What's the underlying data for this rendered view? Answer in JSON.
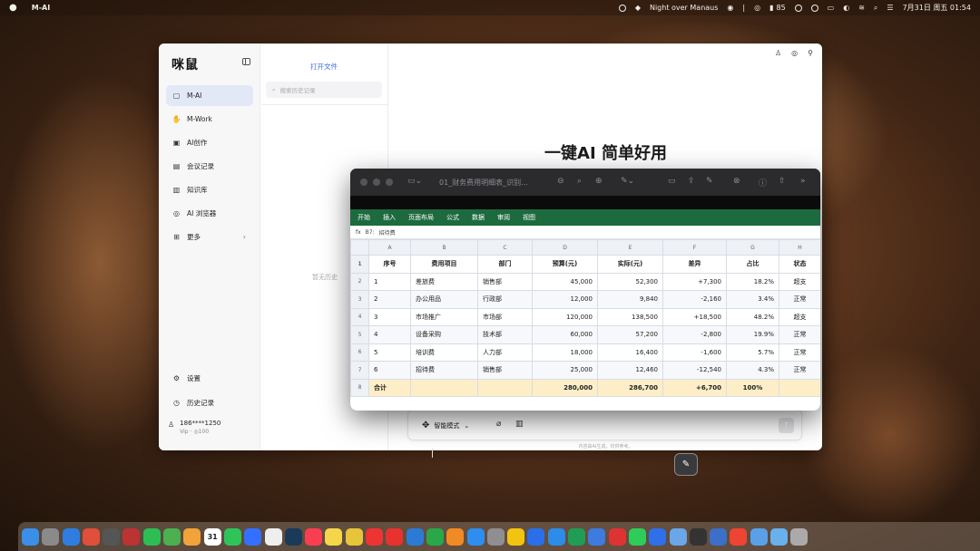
{
  "menubar": {
    "app_name": "M-AI",
    "now_playing": "Night over Manaus",
    "battery": "85",
    "datetime": "7月31日 周五 01:54"
  },
  "sidebar": {
    "logo": "咪鼠",
    "items": [
      {
        "label": "M-AI",
        "icon": "chat-icon",
        "active": true
      },
      {
        "label": "M-Work",
        "icon": "hand-icon"
      },
      {
        "label": "AI创作",
        "icon": "image-icon"
      },
      {
        "label": "会议记录",
        "icon": "meeting-icon"
      },
      {
        "label": "知识库",
        "icon": "book-icon"
      },
      {
        "label": "AI 浏览器",
        "icon": "compass-icon"
      },
      {
        "label": "更多",
        "icon": "grid-icon",
        "has_chevron": true
      }
    ],
    "bottom": [
      {
        "label": "设置",
        "icon": "gear-icon"
      },
      {
        "label": "历史记录",
        "icon": "history-icon"
      }
    ],
    "user": {
      "name": "186****1250",
      "tier": "Vip",
      "points": "100"
    }
  },
  "history": {
    "open_file": "打开文件",
    "search_placeholder": "搜索历史记录",
    "empty": "暂无历史"
  },
  "main": {
    "headline": "一键AI 简单好用",
    "mode_label": "智能模式",
    "disclaimer": "内容由AI生成，仅供参考。"
  },
  "sheet": {
    "file_name": "01_财务费用明细表_识别...",
    "ribbon": [
      "开始",
      "插入",
      "页面布局",
      "公式",
      "数据",
      "审阅",
      "视图"
    ],
    "formula_bar": {
      "fx": "fx",
      "cell": "B7:",
      "value": "招待费"
    },
    "columns": [
      "A",
      "B",
      "C",
      "D",
      "E",
      "F",
      "G",
      "H"
    ],
    "header": [
      "序号",
      "费用项目",
      "部门",
      "预算(元)",
      "实际(元)",
      "差异",
      "占比",
      "状态"
    ],
    "rows": [
      [
        "1",
        "差旅费",
        "销售部",
        "45,000",
        "52,300",
        "+7,300",
        "18.2%",
        "超支"
      ],
      [
        "2",
        "办公用品",
        "行政部",
        "12,000",
        "9,840",
        "-2,160",
        "3.4%",
        "正常"
      ],
      [
        "3",
        "市场推广",
        "市场部",
        "120,000",
        "138,500",
        "+18,500",
        "48.2%",
        "超支"
      ],
      [
        "4",
        "设备采购",
        "技术部",
        "60,000",
        "57,200",
        "-2,800",
        "19.9%",
        "正常"
      ],
      [
        "5",
        "培训费",
        "人力部",
        "18,000",
        "16,400",
        "-1,600",
        "5.7%",
        "正常"
      ],
      [
        "6",
        "招待费",
        "销售部",
        "25,000",
        "12,460",
        "-12,540",
        "4.3%",
        "正常"
      ]
    ],
    "total": [
      "合计",
      "",
      "",
      "280,000",
      "286,700",
      "+6,700",
      "100%",
      ""
    ]
  },
  "dock": [
    {
      "name": "finder-icon",
      "color": "#3b8fe8"
    },
    {
      "name": "launchpad-icon",
      "color": "#8a8a8a"
    },
    {
      "name": "safari-icon",
      "color": "#2f7de0"
    },
    {
      "name": "chrome-icon",
      "color": "#e04f3a"
    },
    {
      "name": "calculator-icon",
      "color": "#555"
    },
    {
      "name": "photo-booth-icon",
      "color": "#b33"
    },
    {
      "name": "wechat-icon",
      "color": "#2dbd52"
    },
    {
      "name": "maps-icon",
      "color": "#4caf50"
    },
    {
      "name": "photos-icon",
      "color": "#f1a33a"
    },
    {
      "name": "calendar-icon",
      "color": "#fff",
      "text": "31"
    },
    {
      "name": "facetime-icon",
      "color": "#2ec45a"
    },
    {
      "name": "feishu-icon",
      "color": "#3370ff"
    },
    {
      "name": "reminders-icon",
      "color": "#eee"
    },
    {
      "name": "stocks-icon",
      "color": "#1a3a5a"
    },
    {
      "name": "music-icon",
      "color": "#fa3e52"
    },
    {
      "name": "notes-icon",
      "color": "#f5d64a"
    },
    {
      "name": "mouse-ai-icon",
      "color": "#e8c43a"
    },
    {
      "name": "netease-music-icon",
      "color": "#e33"
    },
    {
      "name": "weibo-icon",
      "color": "#e8322e"
    },
    {
      "name": "keynote-icon",
      "color": "#2b7bd6"
    },
    {
      "name": "numbers-icon",
      "color": "#29a84a"
    },
    {
      "name": "pages-icon",
      "color": "#f08a24"
    },
    {
      "name": "app-store-icon",
      "color": "#2d8ef0"
    },
    {
      "name": "settings-icon",
      "color": "#8e8e93"
    },
    {
      "name": "qq-icon",
      "color": "#f2c40f"
    },
    {
      "name": "tencent-docs-icon",
      "color": "#2a6fe8"
    },
    {
      "name": "mail-icon",
      "color": "#2c8ce8"
    },
    {
      "name": "password-icon",
      "color": "#1f9d55"
    },
    {
      "name": "preview-icon",
      "color": "#3d7be0"
    },
    {
      "name": "bear-icon",
      "color": "#d33"
    },
    {
      "name": "messages-icon",
      "color": "#2fcc5a"
    },
    {
      "name": "qqmusic-icon",
      "color": "#2f6fe8"
    },
    {
      "name": "finder2-icon",
      "color": "#6aa6e8"
    },
    {
      "name": "terminal-icon",
      "color": "#333"
    },
    {
      "name": "globe-icon",
      "color": "#3b6fc8"
    },
    {
      "name": "smzdm-icon",
      "color": "#e43"
    },
    {
      "name": "folder-icon",
      "color": "#5aa0e8"
    },
    {
      "name": "downloads-icon",
      "color": "#6ab0ea"
    },
    {
      "name": "trash-icon",
      "color": "#aaa"
    }
  ]
}
